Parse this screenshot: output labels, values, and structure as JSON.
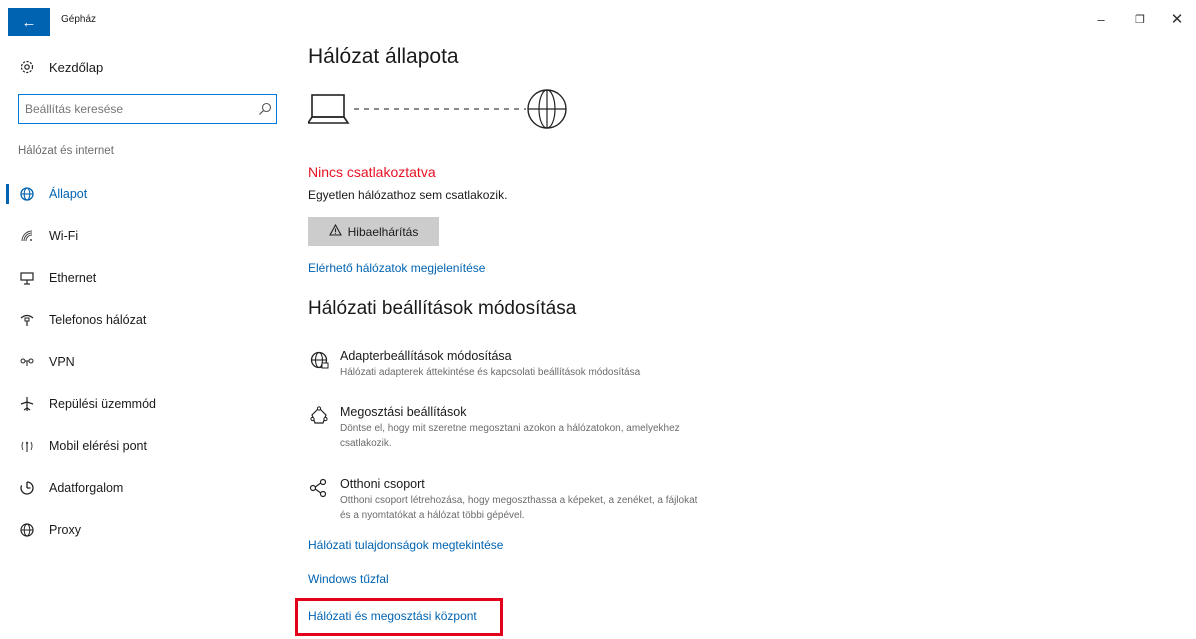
{
  "window": {
    "title": "Gépház",
    "back_icon": "back-arrow-icon",
    "minimize_glyph": "–",
    "restore_glyph": "❐",
    "close_glyph": "✕"
  },
  "sidebar": {
    "home_label": "Kezdőlap",
    "search_placeholder": "Beállítás keresése",
    "section_label": "Hálózat és internet",
    "items": [
      {
        "label": "Állapot",
        "icon": "globe-status-icon",
        "active": true
      },
      {
        "label": "Wi-Fi",
        "icon": "wifi-icon",
        "active": false
      },
      {
        "label": "Ethernet",
        "icon": "ethernet-icon",
        "active": false
      },
      {
        "label": "Telefonos hálózat",
        "icon": "dialup-icon",
        "active": false
      },
      {
        "label": "VPN",
        "icon": "vpn-icon",
        "active": false
      },
      {
        "label": "Repülési üzemmód",
        "icon": "airplane-icon",
        "active": false
      },
      {
        "label": "Mobil elérési pont",
        "icon": "hotspot-icon",
        "active": false
      },
      {
        "label": "Adatforgalom",
        "icon": "data-usage-icon",
        "active": false
      },
      {
        "label": "Proxy",
        "icon": "proxy-globe-icon",
        "active": false
      }
    ]
  },
  "main": {
    "title": "Hálózat állapota",
    "status_title": "Nincs csatlakoztatva",
    "status_desc": "Egyetlen hálózathoz sem csatlakozik.",
    "troubleshoot_label": "Hibaelhárítás",
    "available_networks_link": "Elérhető hálózatok megjelenítése",
    "section_title": "Hálózati beállítások módosítása",
    "settings": [
      {
        "title": "Adapterbeállítások módosítása",
        "desc": "Hálózati adapterek áttekintése és kapcsolati beállítások módosítása"
      },
      {
        "title": "Megosztási beállítások",
        "desc": "Döntse el, hogy mit szeretne megosztani azokon a hálózatokon, amelyekhez csatlakozik."
      },
      {
        "title": "Otthoni csoport",
        "desc": "Otthoni csoport létrehozása, hogy megoszthassa a képeket, a zenéket, a fájlokat és a nyomtatókat a hálózat többi gépével."
      }
    ],
    "links": {
      "properties": "Hálózati tulajdonságok megtekintése",
      "firewall": "Windows tűzfal",
      "sharing_center": "Hálózati és megosztási központ"
    }
  },
  "colors": {
    "accent": "#0063b1",
    "error": "#e81123",
    "highlight_box": "#e3001b"
  }
}
